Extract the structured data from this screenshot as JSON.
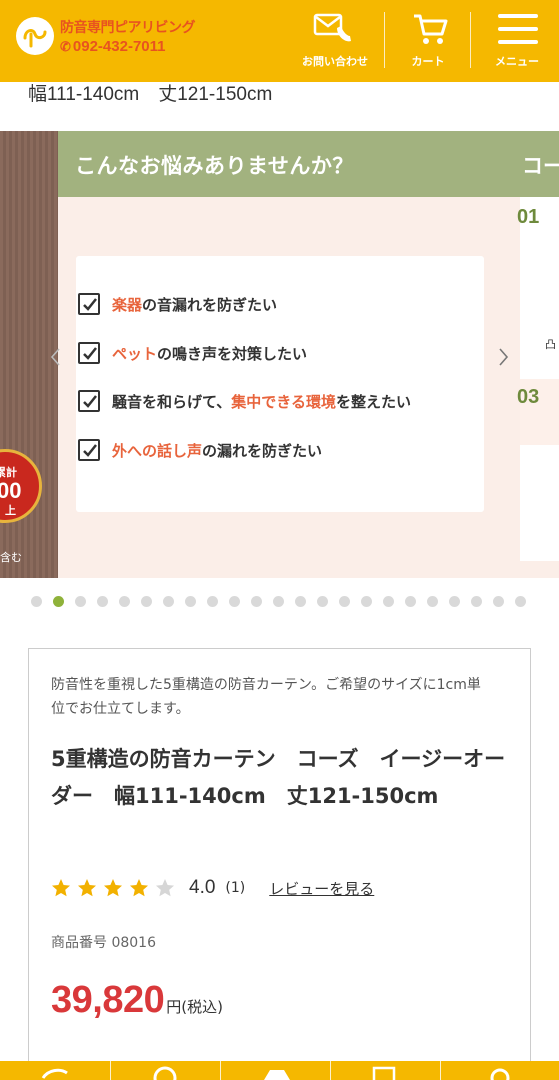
{
  "header": {
    "brand_name": "防音専門ピアリビング",
    "phone": "092-432-7011",
    "contact_label": "お問い合わせ",
    "cart_label": "カート",
    "menu_label": "メニュー",
    "icons": [
      "logo-icon",
      "phone-icon",
      "contact-icon",
      "cart-icon",
      "menu-icon"
    ]
  },
  "size_line": "幅111-140cm　丈121-150cm",
  "slider": {
    "prev_badge": {
      "top": "累計",
      "middle": "00",
      "bottom": "上",
      "caption": "含む"
    },
    "slide_title": "こんなお悩みありませんか？",
    "checks": [
      {
        "highlight": "楽器",
        "rest": "の音漏れを防ぎたい"
      },
      {
        "highlight": "ペット",
        "rest": "の鳴き声を対策したい"
      },
      {
        "prefix": "騒音を和らげて、",
        "highlight": "集中できる環境",
        "rest": "を整えたい"
      },
      {
        "highlight": "外への話し声",
        "rest": "の漏れを防ぎたい"
      }
    ],
    "next_title": "コー",
    "next_numbers": [
      "01",
      "03"
    ],
    "next_glyph": "凸",
    "dot_count": 23,
    "active_dot": 2
  },
  "product": {
    "description": "防音性を重視した5重構造の防音カーテン。ご希望のサイズに1cm単位でお仕立てします。",
    "name": "5重構造の防音カーテン　コーズ　イージーオーダー　幅111-140cm　丈121-150cm",
    "rating": 4.0,
    "rating_text": "4.0",
    "review_count": "(1)",
    "review_link": "レビューを見る",
    "code": "商品番号 08016",
    "price": "39,820",
    "price_unit": "円(税込)"
  },
  "colors": {
    "brand_yellow": "#f5b800",
    "brand_orange": "#e8531f",
    "accent_green": "#a2b27f",
    "highlight_orange": "#e8643c",
    "price_red": "#d9383a",
    "star_gold": "#f2b100"
  }
}
